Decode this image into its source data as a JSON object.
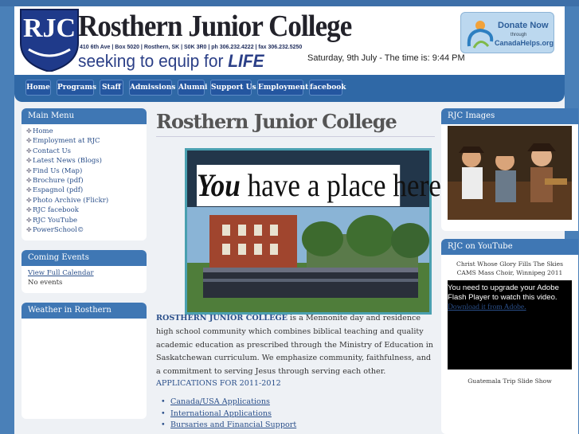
{
  "header": {
    "logo_text": "RJC",
    "title": "Rosthern Junior College",
    "address": "410 6th Ave | Box 5020 | Rosthern, SK | S0K 3R0 | ph 306.232.4222 | fax 306.232.5250",
    "tagline_prefix": "seeking to equip for",
    "tagline_emphasis": "LIFE",
    "datetime": "Saturday, 9th July - The time is: 9:44 PM",
    "donate": {
      "line1": "Donate Now",
      "line2": "through",
      "line3": "CanadaHelps.org"
    }
  },
  "nav": {
    "items": [
      "Home",
      "Programs",
      "Staff",
      "Admissions",
      "Alumni",
      "Support Us",
      "Employment",
      "facebook"
    ]
  },
  "left": {
    "main_menu_title": "Main Menu",
    "main_menu": [
      "Home",
      "Employment at RJC",
      "Contact Us",
      "Latest News (Blogs)",
      "Find Us (Map)",
      "Brochure (pdf)",
      "Espagnol (pdf)",
      "Photo Archive (Flickr)",
      "RJC facebook",
      "RJC YouTube",
      "PowerSchool©"
    ],
    "events_title": "Coming Events",
    "events_link": "View Full Calendar",
    "events_none": "No events",
    "weather_title": "Weather in Rosthern"
  },
  "main": {
    "title": "Rosthern Junior College",
    "hero_caption_you": "You",
    "hero_caption_rest": " have a place here!",
    "intro_bold": "ROSTHERN JUNIOR COLLEGE",
    "intro_rest": " is a Mennonite day and residence high school community which combines biblical teaching and quality academic education as prescribed through the Ministry of Education in Saskatchewan curriculum. We emphasize community, faithfulness, and a commitment to serving Jesus through serving each other.",
    "apps_title": "APPLICATIONS FOR 2011-2012",
    "apps": [
      "Canada/USA Applications",
      "International Applications",
      "Bursaries and Financial Support"
    ]
  },
  "right": {
    "images_title": "RJC Images",
    "youtube_title": "RJC on YouTube",
    "video_caption_1": "Christ Whose Glory Fills The Skies",
    "video_caption_2": "CAMS Mass Choir, Winnipeg 2011",
    "flash_msg": "You need to upgrade your Adobe Flash Player to watch this video.",
    "flash_link": "Download it from Adobe.",
    "slideshow_caption": "Guatemala Trip Slide Show"
  },
  "colors": {
    "accent": "#3f77b4",
    "page_bg": "#4a80b8",
    "link": "#2a4f8a"
  }
}
